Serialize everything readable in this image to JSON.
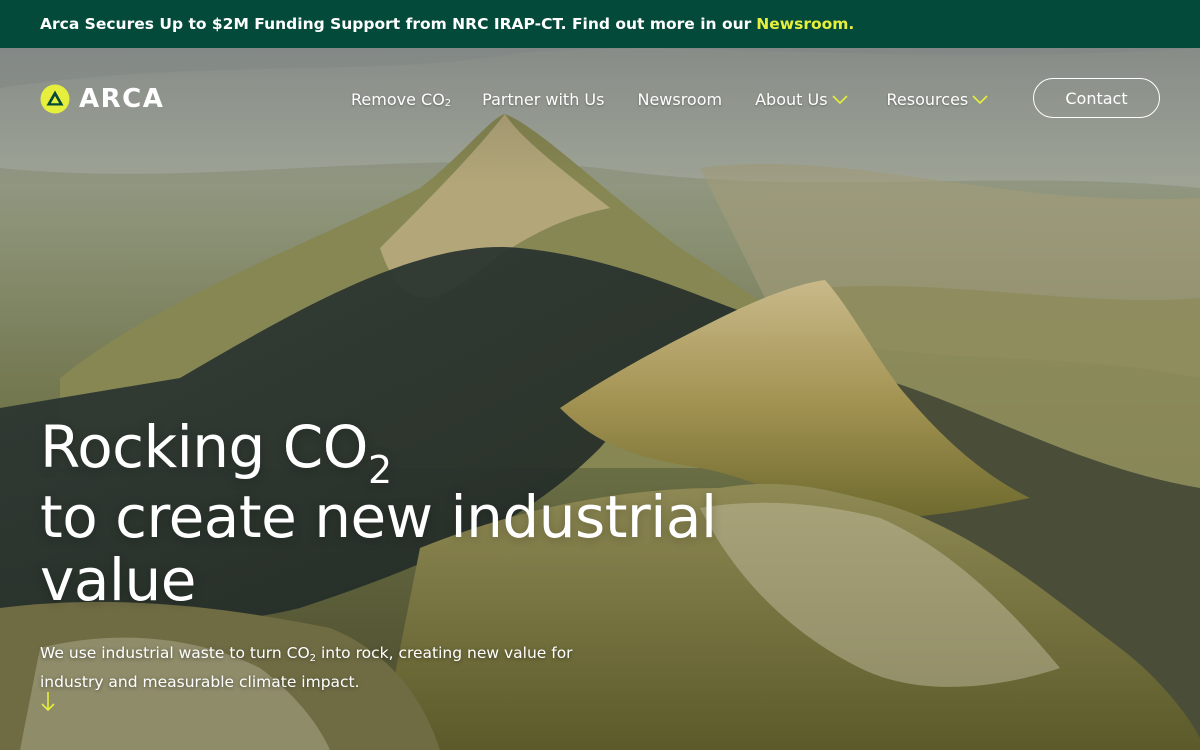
{
  "announcement": {
    "text": "Arca Secures Up to $2M Funding Support from NRC IRAP-CT. Find out more in our",
    "link_label": "Newsroom."
  },
  "brand": {
    "name": "ARCA",
    "logo_icon": "triangle-in-circle-icon"
  },
  "nav": {
    "remove_prefix": "Remove CO",
    "remove_sub": "2",
    "partner": "Partner with Us",
    "newsroom": "Newsroom",
    "about": "About Us",
    "resources": "Resources",
    "contact": "Contact",
    "dropdown_icon": "chevron-down-icon"
  },
  "hero": {
    "headline_line1": "Rocking CO",
    "headline_line1_sub": "2",
    "headline_line2": "to create new industrial",
    "headline_line3": "value",
    "lede_part1": "We use industrial waste to turn CO",
    "lede_sub": "2",
    "lede_part2": " into rock, creating new value for industry and measurable climate impact.",
    "scroll_icon": "arrow-down-icon"
  },
  "colors": {
    "banner_bg": "#034a3a",
    "accent": "#e6ef3c",
    "text": "#ffffff"
  }
}
